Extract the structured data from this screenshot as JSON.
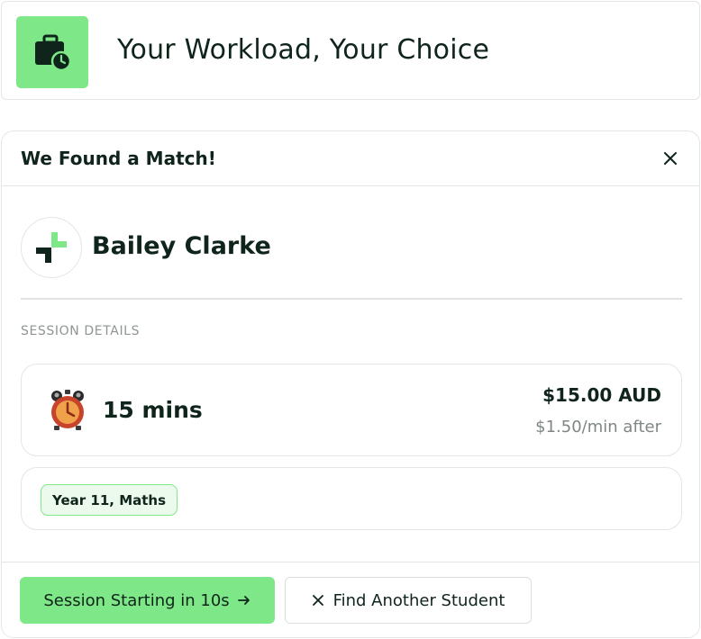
{
  "header": {
    "title": "Your Workload, Your Choice",
    "icon": "briefcase-clock-icon",
    "accent_color": "#7ee787"
  },
  "modal": {
    "title": "We Found a Match!",
    "close_icon": "close-icon",
    "student": {
      "name": "Bailey Clarke",
      "avatar_icon": "plus-logo-icon"
    },
    "section_label": "SESSION DETAILS",
    "session": {
      "icon": "alarm-clock-icon",
      "duration": "15 mins",
      "price": "$15.00 AUD",
      "rate": "$1.50/min after"
    },
    "subject_tag": "Year 11, Maths",
    "actions": {
      "primary_label": "Session Starting in 10s",
      "primary_icon": "arrow-right-icon",
      "secondary_label": "Find Another Student",
      "secondary_icon": "close-icon"
    }
  }
}
